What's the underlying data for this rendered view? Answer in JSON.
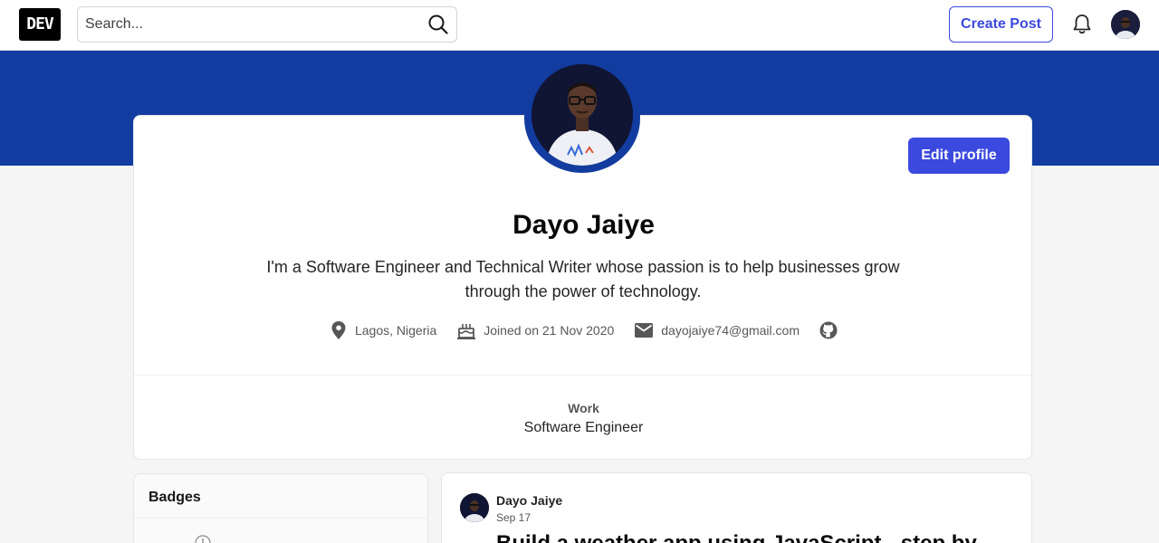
{
  "header": {
    "logo_text": "DEV",
    "search_placeholder": "Search...",
    "create_post_label": "Create Post",
    "icons": [
      "search-icon",
      "bell-icon",
      "avatar"
    ]
  },
  "profile": {
    "name": "Dayo Jaiye",
    "bio": "I'm a Software Engineer and Technical Writer whose passion is to help businesses grow through the power of technology.",
    "edit_label": "Edit profile",
    "location": "Lagos, Nigeria",
    "joined": "Joined on 21 Nov 2020",
    "email": "dayojaiye74@gmail.com",
    "work_label": "Work",
    "work_value": "Software Engineer"
  },
  "badges": {
    "title": "Badges"
  },
  "post": {
    "author": "Dayo Jaiye",
    "date": "Sep 17",
    "title": "Build a weather app using JavaScript - step by"
  },
  "colors": {
    "accent": "#3b49df",
    "banner": "#123ca0",
    "background": "#f5f5f5"
  }
}
